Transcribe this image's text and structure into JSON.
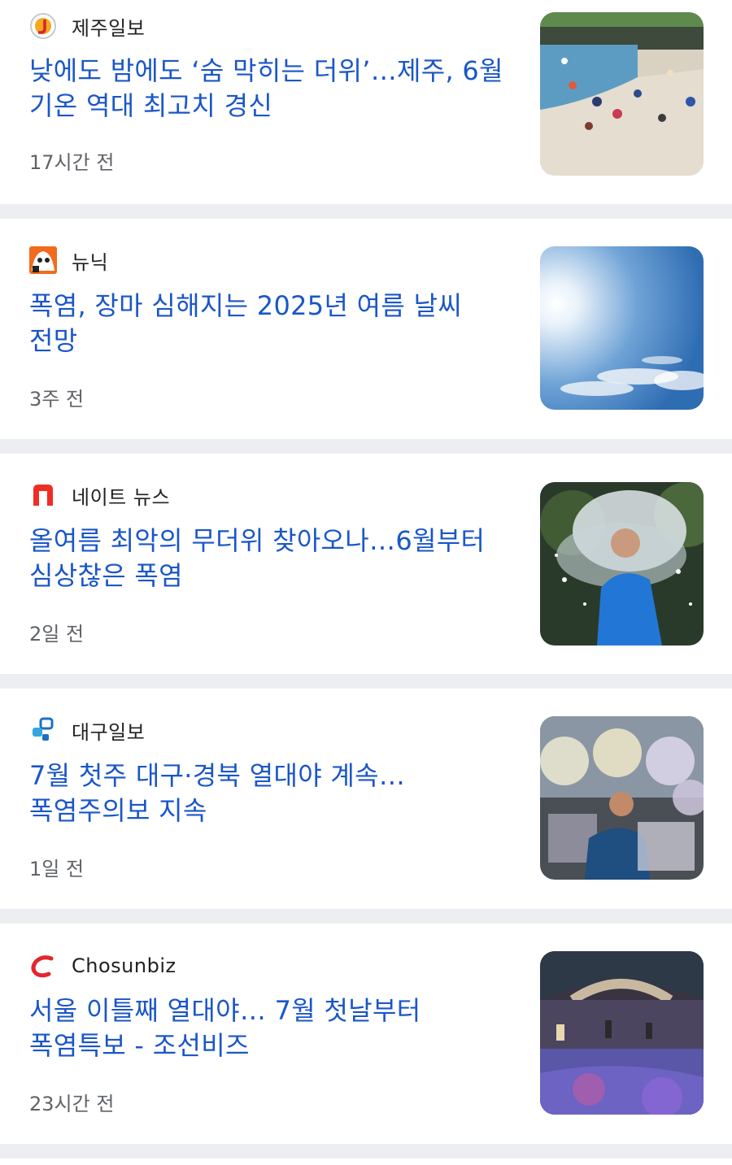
{
  "articles": [
    {
      "source": "제주일보",
      "source_icon": "jeju-ilbo-logo-icon",
      "headline": "낮에도 밤에도 ‘숨 막히는 더위’…제주, 6월 기온 역대 최고치 경신",
      "time": "17시간 전",
      "thumbnail": "beach-crowd-photo"
    },
    {
      "source": "뉴닉",
      "source_icon": "newneek-logo-icon",
      "headline": "폭염, 장마 심해지는 2025년 여름 날씨 전망",
      "time": "3주 전",
      "thumbnail": "sunny-sky-photo"
    },
    {
      "source": "네이트 뉴스",
      "source_icon": "nate-news-logo-icon",
      "headline": "올여름 최악의 무더위 찾아오나…6월부터 심상찮은 폭염",
      "time": "2일 전",
      "thumbnail": "water-splash-photo"
    },
    {
      "source": "대구일보",
      "source_icon": "daegu-ilbo-logo-icon",
      "headline": "7월 첫주 대구·경북 열대야 계속…폭염주의보 지속",
      "time": "1일 전",
      "thumbnail": "fans-child-photo"
    },
    {
      "source": "Chosunbiz",
      "source_icon": "chosunbiz-logo-icon",
      "headline": "서울 이틀째 열대야… 7월 첫날부터 폭염특보 - 조선비즈",
      "time": "23시간 전",
      "thumbnail": "night-stream-photo"
    }
  ],
  "colors": {
    "headline": "#1a56c8",
    "source": "#202124",
    "time": "#5f6368",
    "divider": "#eceef1"
  }
}
